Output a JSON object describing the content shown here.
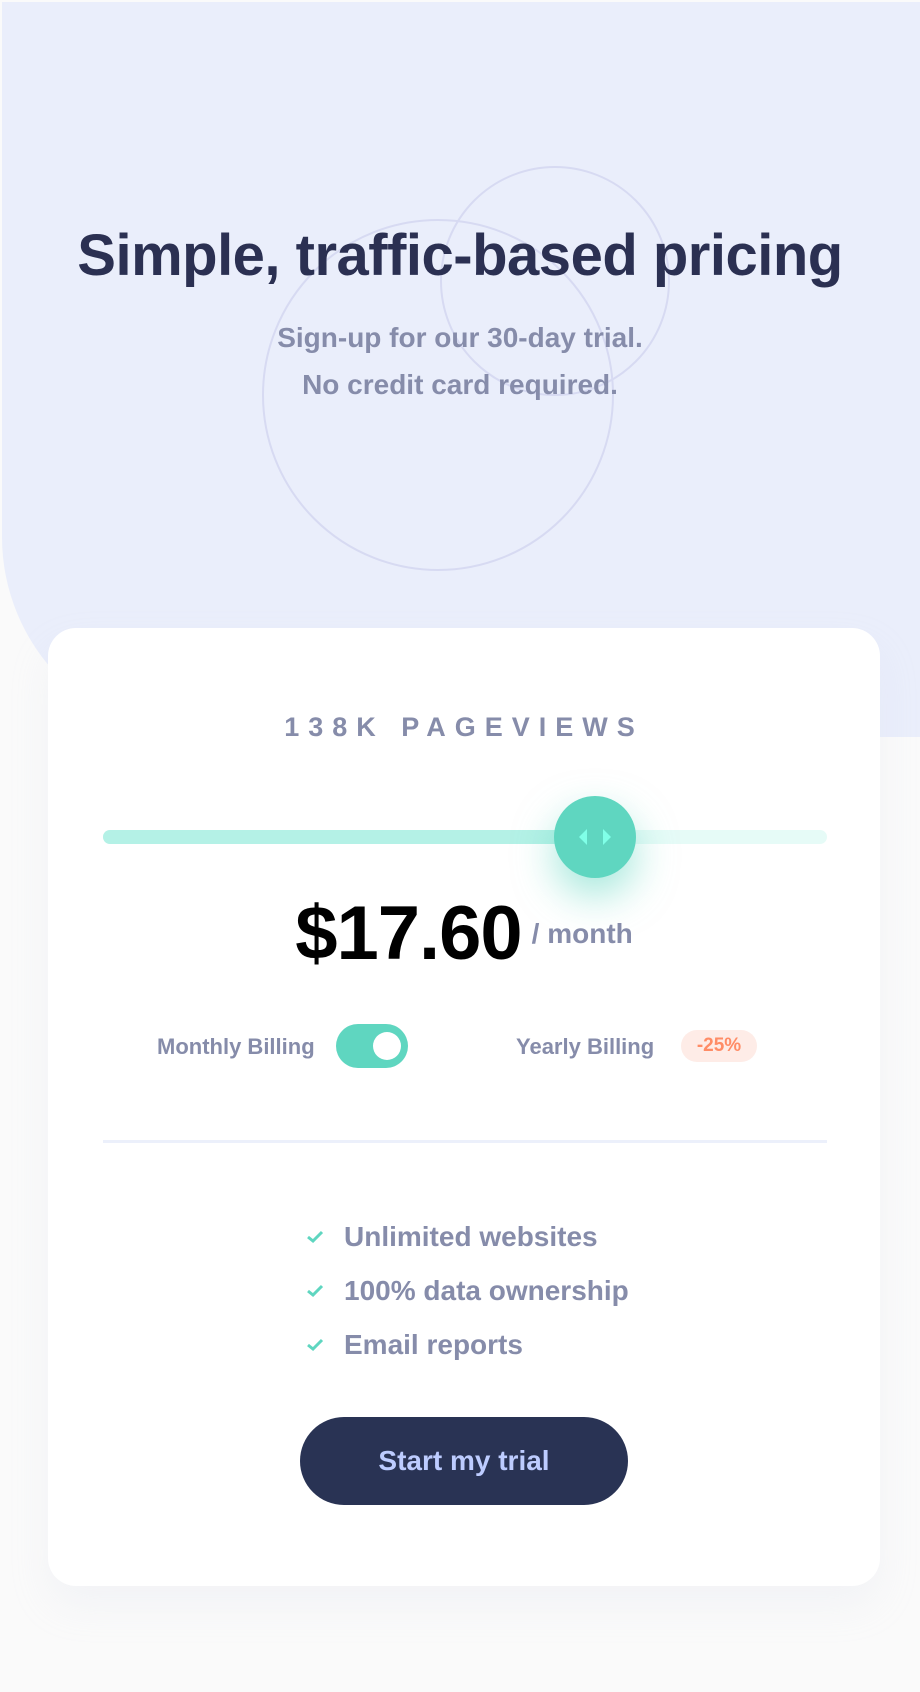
{
  "hero": {
    "title": "Simple, traffic-based pricing",
    "subtitle_line1": "Sign-up for our 30-day trial.",
    "subtitle_line2": "No credit card required."
  },
  "pricing": {
    "pageviews_label": "138K PAGEVIEWS",
    "slider_level_percent": 68,
    "price": "$17.60",
    "period": "/ month"
  },
  "billing": {
    "monthly_label": "Monthly Billing",
    "yearly_label": "Yearly Billing",
    "discount": "-25%",
    "toggle_state": "yearly"
  },
  "features": [
    "Unlimited websites",
    "100% data ownership",
    "Email reports"
  ],
  "cta": {
    "label": "Start my trial"
  },
  "colors": {
    "hero_background": "#eaeefb",
    "title": "#2b3052",
    "muted_text": "#868caa",
    "accent": "#5fd6c0",
    "slider_fill": "#b4f1e6",
    "slider_track": "#e6fbf7",
    "discount_text": "#ff8c66",
    "discount_background": "#feece7",
    "button_background": "#293354",
    "button_text": "#bdccff"
  },
  "icons": [
    "slider-arrows-icon",
    "check-icon"
  ]
}
